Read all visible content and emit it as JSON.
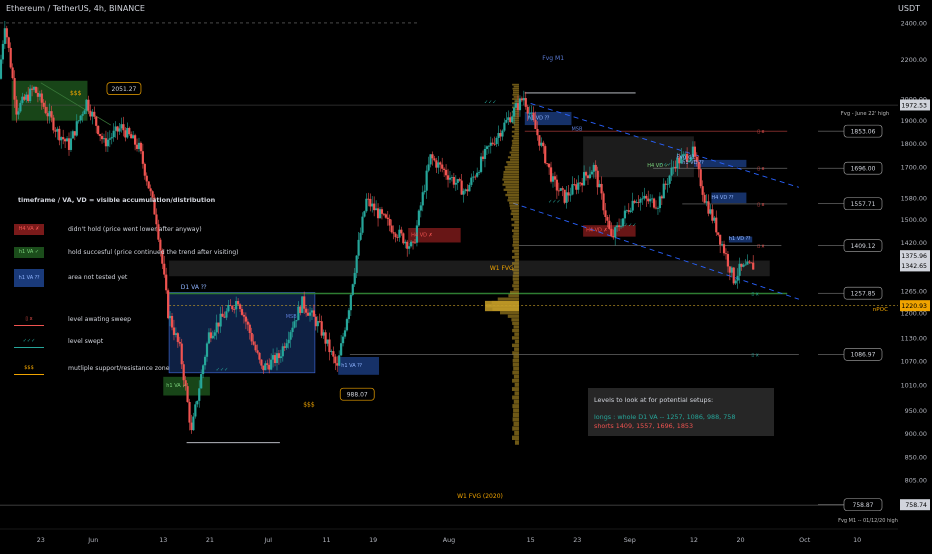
{
  "header": {
    "title": "Ethereum / TetherUS, 4h, BINANCE",
    "currency": "USDT"
  },
  "colors": {
    "up": "#26a69a",
    "down": "#ef5350",
    "accent_orange": "#f0a400",
    "volume_profile": "#c8a028",
    "level_green": "#2e7d32",
    "zone_blue": "#1a3a7a",
    "zone_red": "#7a1a1a",
    "dashed_blue": "#2962ff"
  },
  "legend": {
    "heading": "timeframe / VA, VD = visible accumulation/distribution",
    "items": [
      {
        "swatch": "H4 VA ✗",
        "text": "didn't hold (price went lower after anyway)"
      },
      {
        "swatch": "h1 VA ✓",
        "text": "hold succesful (price continued the trend after visiting)"
      },
      {
        "swatch": "h1 VA ⁇",
        "text": "area not tested yet"
      },
      {
        "swatch": "▯ x",
        "text": "level awating sweep"
      },
      {
        "swatch": "✓✓✓",
        "text": "level swept"
      },
      {
        "swatch": "$$$",
        "text": "mutliple support/resistance zone"
      }
    ]
  },
  "setups": {
    "heading": "Levels to look at for potential setups:",
    "longs": "longs : whole D1 VA -- 1257, 1086, 988, 758",
    "shorts": "shorts 1409, 1557, 1696, 1853"
  },
  "chart_data": {
    "type": "candlestick",
    "title": "Ethereum / TetherUS, 4h, BINANCE",
    "y_axis": {
      "range": [
        735,
        2440
      ],
      "ticks": [
        2400,
        2200,
        2000,
        1900,
        1800,
        1700,
        1580,
        1500,
        1420,
        1340,
        1265,
        1200,
        1130,
        1070,
        1010,
        950,
        900,
        850,
        805,
        758
      ],
      "tick_labels": [
        "2400.00",
        "2200.00",
        "2000.00",
        "1900.00",
        "1800.00",
        "1700.00",
        "1580.00",
        "1500.00",
        "1420.00",
        "1340.00",
        "1265.00",
        "1200.00",
        "1130.00",
        "1070.00",
        "1010.00",
        "950.00",
        "900.00",
        "850.00",
        "805.00",
        "758.00"
      ],
      "scale": "log"
    },
    "x_axis": {
      "range": [
        "2022-05-16",
        "2022-10-17"
      ],
      "ticks": [
        {
          "date": "2022-05-23",
          "label": "23"
        },
        {
          "date": "2022-06-01",
          "label": "Jun"
        },
        {
          "date": "2022-06-13",
          "label": "13"
        },
        {
          "date": "2022-06-21",
          "label": "21"
        },
        {
          "date": "2022-07-01",
          "label": "Jul"
        },
        {
          "date": "2022-07-11",
          "label": "11"
        },
        {
          "date": "2022-07-19",
          "label": "19"
        },
        {
          "date": "2022-08-01",
          "label": "Aug"
        },
        {
          "date": "2022-08-15",
          "label": "15"
        },
        {
          "date": "2022-08-23",
          "label": "23"
        },
        {
          "date": "2022-09-01",
          "label": "Sep"
        },
        {
          "date": "2022-09-12",
          "label": "12"
        },
        {
          "date": "2022-09-20",
          "label": "20"
        },
        {
          "date": "2022-10-01",
          "label": "Oct"
        },
        {
          "date": "2022-10-10",
          "label": "10"
        }
      ]
    },
    "price_path": [
      {
        "date": "2022-05-16",
        "value": 2100
      },
      {
        "date": "2022-05-17",
        "value": 2400
      },
      {
        "date": "2022-05-19",
        "value": 1950
      },
      {
        "date": "2022-05-22",
        "value": 2050
      },
      {
        "date": "2022-05-26",
        "value": 1850
      },
      {
        "date": "2022-05-28",
        "value": 1790
      },
      {
        "date": "2022-05-31",
        "value": 1990
      },
      {
        "date": "2022-06-03",
        "value": 1800
      },
      {
        "date": "2022-06-06",
        "value": 1870
      },
      {
        "date": "2022-06-09",
        "value": 1780
      },
      {
        "date": "2022-06-12",
        "value": 1500
      },
      {
        "date": "2022-06-14",
        "value": 1200
      },
      {
        "date": "2022-06-16",
        "value": 1100
      },
      {
        "date": "2022-06-18",
        "value": 900
      },
      {
        "date": "2022-06-21",
        "value": 1140
      },
      {
        "date": "2022-06-26",
        "value": 1240
      },
      {
        "date": "2022-06-30",
        "value": 1050
      },
      {
        "date": "2022-07-03",
        "value": 1080
      },
      {
        "date": "2022-07-07",
        "value": 1230
      },
      {
        "date": "2022-07-10",
        "value": 1160
      },
      {
        "date": "2022-07-13",
        "value": 1050
      },
      {
        "date": "2022-07-15",
        "value": 1220
      },
      {
        "date": "2022-07-18",
        "value": 1570
      },
      {
        "date": "2022-07-21",
        "value": 1500
      },
      {
        "date": "2022-07-26",
        "value": 1400
      },
      {
        "date": "2022-07-29",
        "value": 1740
      },
      {
        "date": "2022-08-04",
        "value": 1600
      },
      {
        "date": "2022-08-08",
        "value": 1780
      },
      {
        "date": "2022-08-14",
        "value": 2010
      },
      {
        "date": "2022-08-19",
        "value": 1640
      },
      {
        "date": "2022-08-21",
        "value": 1580
      },
      {
        "date": "2022-08-26",
        "value": 1700
      },
      {
        "date": "2022-08-29",
        "value": 1430
      },
      {
        "date": "2022-09-02",
        "value": 1580
      },
      {
        "date": "2022-09-06",
        "value": 1560
      },
      {
        "date": "2022-09-09",
        "value": 1720
      },
      {
        "date": "2022-09-12",
        "value": 1760
      },
      {
        "date": "2022-09-14",
        "value": 1580
      },
      {
        "date": "2022-09-16",
        "value": 1470
      },
      {
        "date": "2022-09-19",
        "value": 1300
      },
      {
        "date": "2022-09-20",
        "value": 1330
      },
      {
        "date": "2022-09-22",
        "value": 1342
      }
    ],
    "price_labels": [
      {
        "value": 1972.53,
        "label": "1972.53",
        "style": "neutral"
      },
      {
        "value": 1375.96,
        "label": "1375.96",
        "style": "neutral"
      },
      {
        "value": 1342.65,
        "label": "1342.65",
        "style": "neutral"
      },
      {
        "value": 1220.93,
        "label": "1220.93",
        "style": "poc"
      },
      {
        "value": 758.74,
        "label": "758.74",
        "style": "neutral"
      }
    ],
    "callouts": [
      {
        "value": 1853.06,
        "label": "1853.06"
      },
      {
        "value": 1696.0,
        "label": "1696.00"
      },
      {
        "value": 1557.71,
        "label": "1557.71"
      },
      {
        "value": 1409.12,
        "label": "1409.12"
      },
      {
        "value": 1257.85,
        "label": "1257.85"
      },
      {
        "value": 1086.97,
        "label": "1086.97"
      },
      {
        "value": 758.87,
        "label": "758.87"
      }
    ],
    "price_boxes": [
      {
        "value": 2051.27,
        "label": "2051.27"
      },
      {
        "value": 988.07,
        "label": "988.07"
      }
    ],
    "annotations": [
      {
        "text": "Fvg M1"
      },
      {
        "text": "Fvg - June 22' high"
      },
      {
        "text": "W1 FVG"
      },
      {
        "text": "W1 FVG (2020)"
      },
      {
        "text": "Fvg M1 -- 01/12/20 high"
      },
      {
        "text": "nPOC"
      },
      {
        "text": "D1 VA ⁇"
      },
      {
        "text": "h1 VA ✓"
      },
      {
        "text": "h1 VA ⁇"
      },
      {
        "text": "H4 VD ✗"
      },
      {
        "text": "H4 VD ✓"
      },
      {
        "text": "h1 VD ⁇"
      },
      {
        "text": "H4 VD ⁇"
      },
      {
        "text": "Fvg d1"
      },
      {
        "text": "MSB"
      },
      {
        "text": "$$$"
      },
      {
        "text": "✓✓✓"
      },
      {
        "text": "▯ x"
      }
    ]
  }
}
